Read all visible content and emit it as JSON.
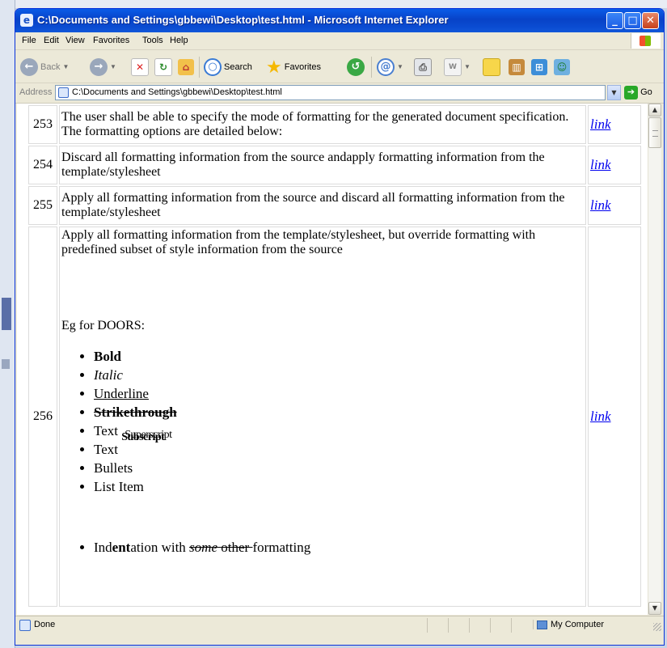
{
  "window": {
    "title": "C:\\Documents and Settings\\gbbewi\\Desktop\\test.html - Microsoft Internet Explorer"
  },
  "menu": [
    "File",
    "Edit",
    "View",
    "Favorites",
    "Tools",
    "Help"
  ],
  "toolbar": {
    "back": "Back",
    "search": "Search",
    "favorites": "Favorites"
  },
  "address": {
    "label": "Address",
    "value": "C:\\Documents and Settings\\gbbewi\\Desktop\\test.html",
    "go": "Go"
  },
  "rows": [
    {
      "num": "253",
      "text": "The user shall be able to specify the mode of formatting for the generated document specification. The formatting options are detailed below:",
      "link": "link"
    },
    {
      "num": "254",
      "text": "Discard all formatting information from the source andapply formatting information from the template/stylesheet",
      "link": "link"
    },
    {
      "num": "255",
      "text": "Apply all formatting information from the source and discard all formatting information from the template/stylesheet",
      "link": "link"
    },
    {
      "num": "256",
      "text": "Apply all formatting information from the template/stylesheet, but override formatting with predefined subset of style information from the source",
      "eg": "Eg for DOORS:",
      "bullets": {
        "bold": "Bold",
        "italic": "Italic",
        "underline": "Underline",
        "strike": "Strikethrough",
        "text1": "Text",
        "sub": "Subscript",
        "sup": "Superscript",
        "text2": "Text",
        "bullets": "Bullets",
        "list_item": "List Item"
      },
      "indent": {
        "a": "Ind",
        "b": "ent",
        "c": "ation with ",
        "d": "some",
        "e": " ",
        "f": "other ",
        "g": "formatting"
      },
      "link": "link"
    }
  ],
  "status": {
    "text": "Done",
    "zone": "My Computer"
  }
}
